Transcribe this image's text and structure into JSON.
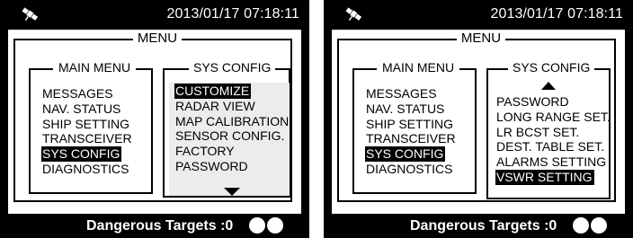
{
  "left_screen": {
    "datetime": "2013/01/17 07:18:11",
    "status_icon": "satellite-icon",
    "menu_title": "MENU",
    "main_menu": {
      "title": "MAIN MENU",
      "items": [
        "MESSAGES",
        "NAV. STATUS",
        "SHIP SETTING",
        "TRANSCEIVER",
        "SYS CONFIG",
        "DIAGNOSTICS"
      ],
      "selected": "SYS CONFIG"
    },
    "sys_config": {
      "title": "SYS CONFIG",
      "items": [
        "CUSTOMIZE",
        "RADAR VIEW",
        "MAP CALIBRATION",
        "SENSOR CONFIG.",
        "FACTORY",
        "PASSWORD"
      ],
      "selected": "CUSTOMIZE",
      "scroll_indicator": "scroll-down-arrow-icon"
    },
    "status_bar": {
      "label": "Dangerous Targets :0"
    }
  },
  "right_screen": {
    "datetime": "2013/01/17 07:18:11",
    "status_icon": "satellite-icon",
    "menu_title": "MENU",
    "main_menu": {
      "title": "MAIN MENU",
      "items": [
        "MESSAGES",
        "NAV. STATUS",
        "SHIP SETTING",
        "TRANSCEIVER",
        "SYS CONFIG",
        "DIAGNOSTICS"
      ],
      "selected": "SYS CONFIG"
    },
    "sys_config": {
      "title": "SYS CONFIG",
      "items": [
        "PASSWORD",
        "LONG RANGE SET.",
        "LR BCST SET.",
        "DEST. TABLE SET.",
        "ALARMS SETTING",
        "VSWR SETTING"
      ],
      "selected": "VSWR SETTING",
      "scroll_indicator": "scroll-up-arrow-icon"
    },
    "status_bar": {
      "label": "Dangerous Targets :0"
    }
  },
  "colors": {
    "screen_background": "#000000",
    "panel_background": "#ffffff",
    "highlight": "#000000",
    "highlight_text": "#ffffff",
    "list_shade_left": "#ececec"
  }
}
